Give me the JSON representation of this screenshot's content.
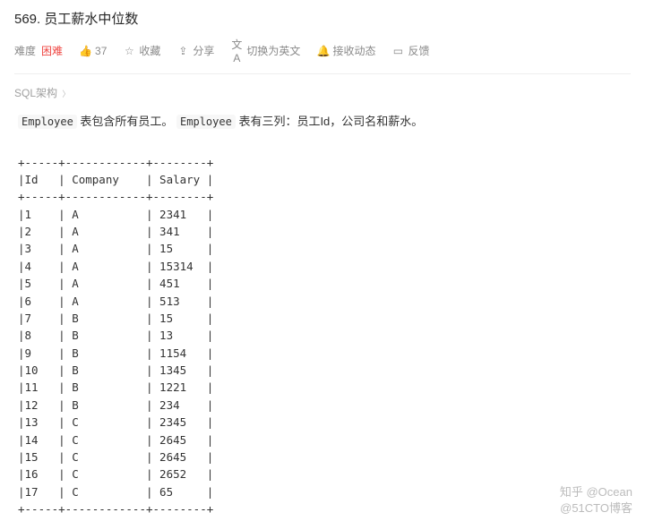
{
  "title": "569. 员工薪水中位数",
  "difficulty_label": "难度",
  "difficulty_value": "困难",
  "like_count": "37",
  "actions": {
    "favorite": "收藏",
    "share": "分享",
    "translate": "切换为英文",
    "notify": "接收动态",
    "feedback": "反馈"
  },
  "sql_schema": "SQL架构",
  "desc_before1": "Employee",
  "desc_mid1": " 表包含所有员工。 ",
  "desc_before2": "Employee",
  "desc_mid2": " 表有三列：员工Id，公司名和薪水。",
  "table_border_top": "+-----+------------+--------+",
  "table_header": "|Id   | Company    | Salary |",
  "rows": [
    {
      "id": "1",
      "company": "A",
      "salary": "2341"
    },
    {
      "id": "2",
      "company": "A",
      "salary": "341"
    },
    {
      "id": "3",
      "company": "A",
      "salary": "15"
    },
    {
      "id": "4",
      "company": "A",
      "salary": "15314"
    },
    {
      "id": "5",
      "company": "A",
      "salary": "451"
    },
    {
      "id": "6",
      "company": "A",
      "salary": "513"
    },
    {
      "id": "7",
      "company": "B",
      "salary": "15"
    },
    {
      "id": "8",
      "company": "B",
      "salary": "13"
    },
    {
      "id": "9",
      "company": "B",
      "salary": "1154"
    },
    {
      "id": "10",
      "company": "B",
      "salary": "1345"
    },
    {
      "id": "11",
      "company": "B",
      "salary": "1221"
    },
    {
      "id": "12",
      "company": "B",
      "salary": "234"
    },
    {
      "id": "13",
      "company": "C",
      "salary": "2345"
    },
    {
      "id": "14",
      "company": "C",
      "salary": "2645"
    },
    {
      "id": "15",
      "company": "C",
      "salary": "2645"
    },
    {
      "id": "16",
      "company": "C",
      "salary": "2652"
    },
    {
      "id": "17",
      "company": "C",
      "salary": "65"
    }
  ],
  "watermark_top": "知乎 @Ocean",
  "watermark_bottom": "@51CTO博客"
}
